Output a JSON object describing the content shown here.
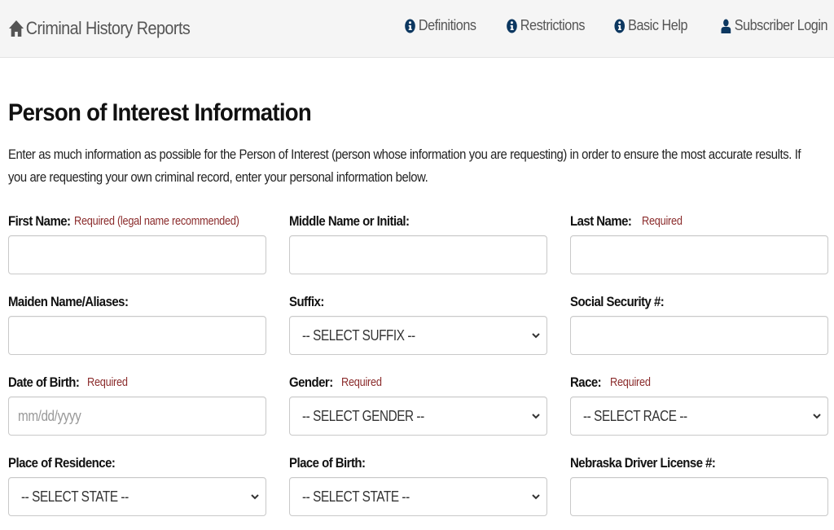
{
  "navbar": {
    "brand": "Criminal History Reports",
    "links": [
      {
        "label": "Definitions",
        "icon": "info-circle-icon"
      },
      {
        "label": "Restrictions",
        "icon": "info-circle-icon"
      },
      {
        "label": "Basic Help",
        "icon": "info-circle-icon"
      },
      {
        "label": "Subscriber Login",
        "icon": "user-icon"
      }
    ]
  },
  "colors": {
    "nav_icon": "#0c3760",
    "required": "#8b2c2c",
    "navbar_bg": "#f5f5f5"
  },
  "main": {
    "title": "Person of Interest Information",
    "intro": "Enter as much information as possible for the Person of Interest (person whose information you are requesting) in order to ensure the most accurate results. If you are requesting your own criminal record, enter your personal information below."
  },
  "form": {
    "first_name": {
      "label": "First Name:",
      "note": "Required (legal name recommended)",
      "value": ""
    },
    "middle_name": {
      "label": "Middle Name or Initial:",
      "value": ""
    },
    "last_name": {
      "label": "Last Name:",
      "note": "Required",
      "value": ""
    },
    "maiden_name": {
      "label": "Maiden Name/Aliases:",
      "value": ""
    },
    "suffix": {
      "label": "Suffix:",
      "selected": "-- SELECT SUFFIX --"
    },
    "ssn": {
      "label": "Social Security #:",
      "value": ""
    },
    "dob": {
      "label": "Date of Birth:",
      "note": "Required",
      "placeholder": "mm/dd/yyyy",
      "value": ""
    },
    "gender": {
      "label": "Gender:",
      "note": "Required",
      "selected": "-- SELECT GENDER --"
    },
    "race": {
      "label": "Race:",
      "note": "Required",
      "selected": "-- SELECT RACE --"
    },
    "residence": {
      "label": "Place of Residence:",
      "selected": "-- SELECT STATE --"
    },
    "birth_place": {
      "label": "Place of Birth:",
      "selected": "-- SELECT STATE --"
    },
    "driver_license": {
      "label": "Nebraska Driver License #:",
      "value": ""
    }
  }
}
